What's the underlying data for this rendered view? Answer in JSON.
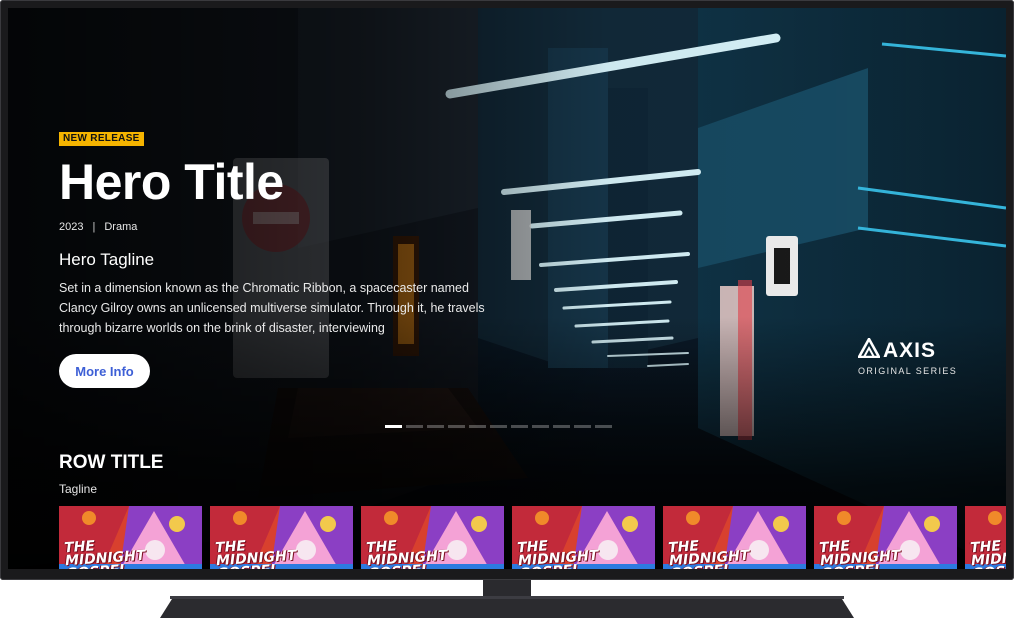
{
  "hero": {
    "badge": "NEW RELEASE",
    "title": "Hero Title",
    "year": "2023",
    "separator": "|",
    "genre": "Drama",
    "tagline": "Hero Tagline",
    "description": "Set in a dimension known as the Chromatic Ribbon, a spacecaster named Clancy Gilroy owns an unlicensed multiverse simulator. Through it, he travels through bizarre worlds on the brink of disaster, interviewing",
    "more_info_label": "More Info"
  },
  "brand": {
    "name": "AXIS",
    "subtitle": "ORIGINAL SERIES",
    "icon": "axis-logo-icon"
  },
  "pager": {
    "count": 11,
    "active_index": 0
  },
  "row": {
    "title": "ROW TITLE",
    "tagline": "Tagline",
    "tiles": [
      {
        "title": "The Midnight Gospel"
      },
      {
        "title": "The Midnight Gospel"
      },
      {
        "title": "The Midnight Gospel"
      },
      {
        "title": "The Midnight Gospel"
      },
      {
        "title": "The Midnight Gospel"
      },
      {
        "title": "The Midnight Gospel"
      },
      {
        "title": "The Midnight Gospel"
      }
    ]
  },
  "colors": {
    "badge": "#f5b400",
    "button_text": "#3d5fd6",
    "accent_neon": "#2bb7e8"
  }
}
